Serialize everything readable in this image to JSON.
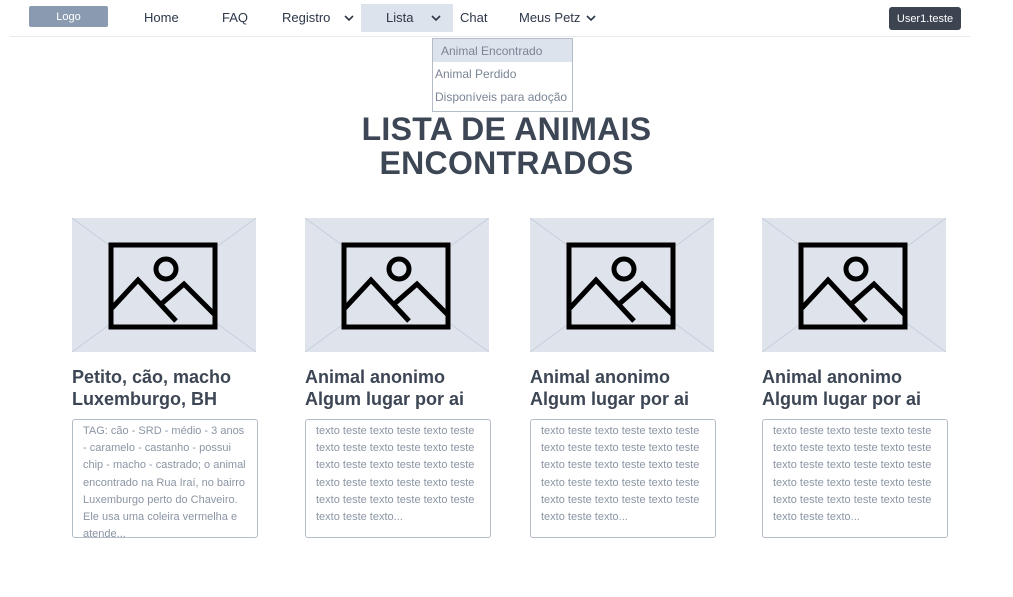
{
  "nav": {
    "logo": "Logo",
    "items": [
      {
        "label": "Home"
      },
      {
        "label": "FAQ"
      },
      {
        "label": "Registro"
      },
      {
        "label": "Lista"
      },
      {
        "label": "Chat"
      },
      {
        "label": "Meus Petz"
      }
    ],
    "user": "User1.teste"
  },
  "dropdown": {
    "options": [
      "Animal Encontrado",
      "Animal Perdido",
      "Disponíveis para adoção"
    ]
  },
  "page": {
    "title_line1": "LISTA DE ANIMAIS",
    "title_line2": "ENCONTRADOS"
  },
  "cards": [
    {
      "title_line1": "Petito, cão, macho",
      "title_line2": "Luxemburgo, BH",
      "description": "TAG: cão - SRD - médio - 3 anos - caramelo - castanho - possui chip - macho - castrado; o animal encontrado na Rua Iraí, no bairro Luxemburgo perto do Chaveiro. Ele usa uma coleira vermelha e atende..."
    },
    {
      "title_line1": "Animal anonimo",
      "title_line2": "Algum lugar por ai",
      "description": "texto teste texto teste texto teste texto teste texto teste texto teste texto teste texto teste texto teste texto teste texto teste texto teste texto teste texto teste texto teste texto teste texto..."
    },
    {
      "title_line1": "Animal anonimo",
      "title_line2": "Algum lugar por ai",
      "description": "texto teste texto teste texto teste texto teste texto teste texto teste texto teste texto teste texto teste texto teste texto teste texto teste texto teste texto teste texto teste texto teste texto..."
    },
    {
      "title_line1": "Animal anonimo",
      "title_line2": "Algum lugar por ai",
      "description": "texto teste texto teste texto teste texto teste texto teste texto teste texto teste texto teste texto teste texto teste texto teste texto teste texto teste texto teste texto teste texto teste texto..."
    }
  ]
}
